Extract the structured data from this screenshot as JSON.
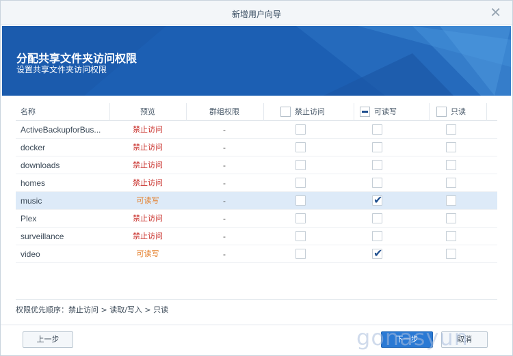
{
  "window": {
    "title": "新增用户向导",
    "close_icon": "close-icon"
  },
  "banner": {
    "heading": "分配共享文件夹访问权限",
    "subheading": "设置共享文件夹访问权限",
    "bg_color": "#1b5fb3"
  },
  "grid": {
    "headers": {
      "name": "名称",
      "preview": "预览",
      "group": "群组权限",
      "deny": "禁止访问",
      "read_write": "可读写",
      "read_only": "只读"
    },
    "header_state": {
      "deny": "unchecked",
      "read_write": "partial",
      "read_only": "unchecked"
    },
    "rows": [
      {
        "name": "ActiveBackupforBus...",
        "preview": "禁止访问",
        "preview_kind": "deny",
        "group": "-",
        "deny": false,
        "rw": false,
        "ro": false,
        "selected": false
      },
      {
        "name": "docker",
        "preview": "禁止访问",
        "preview_kind": "deny",
        "group": "-",
        "deny": false,
        "rw": false,
        "ro": false,
        "selected": false
      },
      {
        "name": "downloads",
        "preview": "禁止访问",
        "preview_kind": "deny",
        "group": "-",
        "deny": false,
        "rw": false,
        "ro": false,
        "selected": false
      },
      {
        "name": "homes",
        "preview": "禁止访问",
        "preview_kind": "deny",
        "group": "-",
        "deny": false,
        "rw": false,
        "ro": false,
        "selected": false
      },
      {
        "name": "music",
        "preview": "可读写",
        "preview_kind": "rw",
        "group": "-",
        "deny": false,
        "rw": true,
        "ro": false,
        "selected": true
      },
      {
        "name": "Plex",
        "preview": "禁止访问",
        "preview_kind": "deny",
        "group": "-",
        "deny": false,
        "rw": false,
        "ro": false,
        "selected": false
      },
      {
        "name": "surveillance",
        "preview": "禁止访问",
        "preview_kind": "deny",
        "group": "-",
        "deny": false,
        "rw": false,
        "ro": false,
        "selected": false
      },
      {
        "name": "video",
        "preview": "可读写",
        "preview_kind": "rw",
        "group": "-",
        "deny": false,
        "rw": true,
        "ro": false,
        "selected": false
      }
    ]
  },
  "note": "权限优先顺序：禁止访问 > 读取/写入 > 只读",
  "buttons": {
    "prev": "上一步",
    "next": "下一步",
    "cancel": "取消"
  },
  "watermark": "gonasyun",
  "colors": {
    "deny": "#c9312c",
    "read_write": "#e47d27",
    "primary": "#2a79d4",
    "selected_row": "#ddeaf8"
  }
}
